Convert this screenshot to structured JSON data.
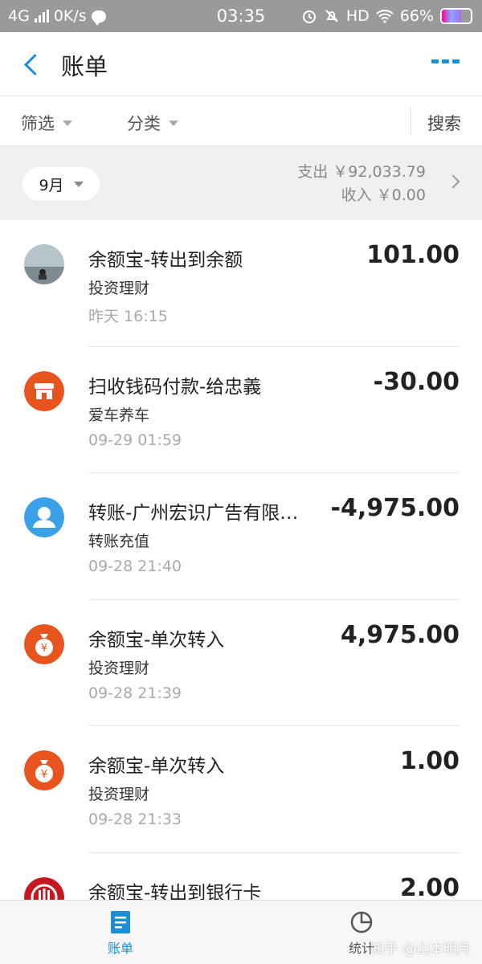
{
  "status_bar": {
    "network": "4G",
    "speed": "0K/s",
    "time": "03:35",
    "hd": "HD",
    "battery": "66%",
    "battery_level": 0.66
  },
  "header": {
    "title": "账单"
  },
  "filters": {
    "filter_label": "筛选",
    "category_label": "分类",
    "search_label": "搜索"
  },
  "summary": {
    "month": "9月",
    "expense": "支出 ￥92,033.79",
    "income": "收入 ￥0.00"
  },
  "transactions": [
    {
      "name": "余额宝-转出到余额",
      "category": "投资理财",
      "time": "昨天 16:15",
      "amount": "101.00",
      "icon": "landscape-photo-avatar"
    },
    {
      "name": "扫收钱码付款-给忠義",
      "category": "爱车养车",
      "time": "09-29 01:59",
      "amount": "-30.00",
      "icon": "shop-icon"
    },
    {
      "name": "转账-广州宏识广告有限…",
      "category": "转账充值",
      "time": "09-28 21:40",
      "amount": "-4,975.00",
      "icon": "person-icon"
    },
    {
      "name": "余额宝-单次转入",
      "category": "投资理财",
      "time": "09-28 21:39",
      "amount": "4,975.00",
      "icon": "money-bag-icon"
    },
    {
      "name": "余额宝-单次转入",
      "category": "投资理财",
      "time": "09-28 21:33",
      "amount": "1.00",
      "icon": "money-bag-icon"
    },
    {
      "name": "余额宝-转出到银行卡",
      "category": "",
      "time": "",
      "amount": "2.00",
      "icon": "bank-icon"
    }
  ],
  "nav": {
    "bills_label": "账单",
    "stats_label": "统计"
  },
  "watermark": "知乎 @山本明月",
  "colors": {
    "accent": "#1a8fd8",
    "orange": "#e8541e",
    "blue_avatar": "#3aa0e8",
    "bank_red": "#c8161e"
  }
}
